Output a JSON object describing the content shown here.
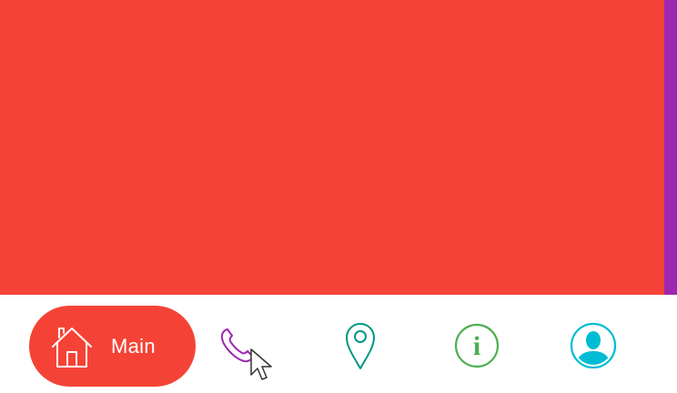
{
  "colors": {
    "active_tab": "#f44336",
    "next_tab_peek": "#9c27b0",
    "phone_icon": "#9c27b0",
    "place_icon": "#009688",
    "info_icon": "#4caf50",
    "user_icon": "#00bcd4"
  },
  "bottom_nav": {
    "items": [
      {
        "icon": "home-icon",
        "label": "Main",
        "active": true
      },
      {
        "icon": "phone-icon",
        "active": false
      },
      {
        "icon": "map-pin-icon",
        "active": false
      },
      {
        "icon": "info-icon",
        "active": false
      },
      {
        "icon": "user-avatar-icon",
        "active": false
      }
    ],
    "info_glyph": "i"
  }
}
